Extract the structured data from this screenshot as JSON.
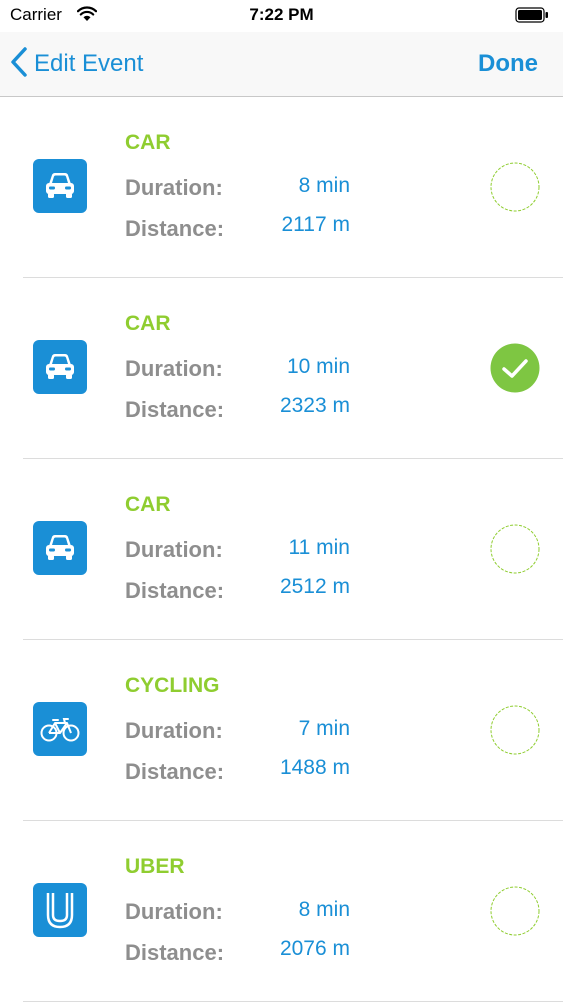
{
  "status_bar": {
    "carrier": "Carrier",
    "time": "7:22 PM"
  },
  "nav": {
    "back_label": "Edit Event",
    "done_label": "Done"
  },
  "labels": {
    "duration": "Duration:",
    "distance": "Distance:"
  },
  "colors": {
    "accent": "#1a8fd6",
    "mode_green": "#8fcd30",
    "label_gray": "#8e8e8e",
    "selected_fill": "#7ec642"
  },
  "options": [
    {
      "mode": "CAR",
      "icon": "car-icon",
      "duration": "8 min",
      "distance": "2117 m",
      "selected": false
    },
    {
      "mode": "CAR",
      "icon": "car-icon",
      "duration": "10 min",
      "distance": "2323 m",
      "selected": true
    },
    {
      "mode": "CAR",
      "icon": "car-icon",
      "duration": "11 min",
      "distance": "2512 m",
      "selected": false
    },
    {
      "mode": "CYCLING",
      "icon": "bicycle-icon",
      "duration": "7 min",
      "distance": "1488 m",
      "selected": false
    },
    {
      "mode": "UBER",
      "icon": "uber-icon",
      "duration": "8 min",
      "distance": "2076 m",
      "selected": false
    }
  ]
}
